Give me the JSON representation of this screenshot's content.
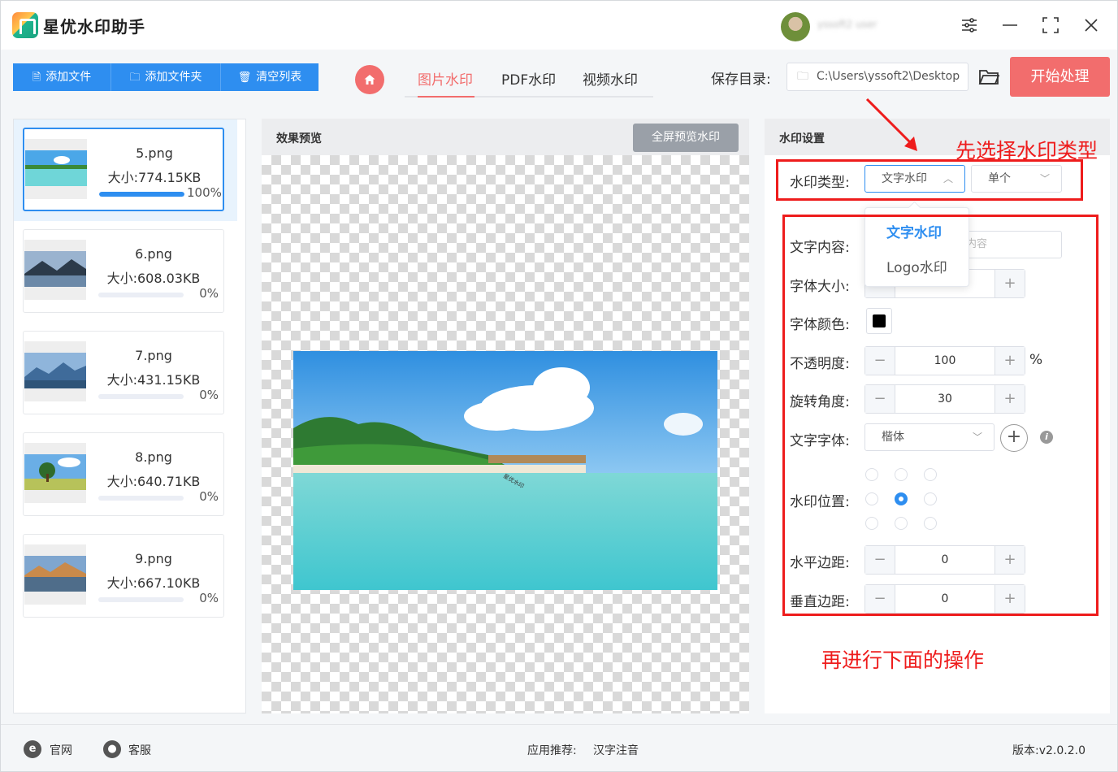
{
  "app": {
    "title": "星优水印助手",
    "user_name": "yssoft2 user"
  },
  "window_controls": {
    "settings_icon": "sliders-icon",
    "minimize_icon": "minimize-icon",
    "maximize_icon": "maximize-icon",
    "close_icon": "close-icon"
  },
  "toolbar": {
    "add_file": "添加文件",
    "add_folder": "添加文件夹",
    "clear_list": "清空列表"
  },
  "tabs": [
    {
      "label": "图片水印",
      "active": true
    },
    {
      "label": "PDF水印"
    },
    {
      "label": "视频水印"
    }
  ],
  "save": {
    "label": "保存目录:",
    "path": "C:\\Users\\yssoft2\\Desktop"
  },
  "start_button": "开始处理",
  "files": [
    {
      "name": "5.png",
      "size": "大小:774.15KB",
      "progress_text": "100%",
      "progress": 1.0,
      "selected": true
    },
    {
      "name": "6.png",
      "size": "大小:608.03KB",
      "progress_text": "0%",
      "progress": 0
    },
    {
      "name": "7.png",
      "size": "大小:431.15KB",
      "progress_text": "0%",
      "progress": 0
    },
    {
      "name": "8.png",
      "size": "大小:640.71KB",
      "progress_text": "0%",
      "progress": 0
    },
    {
      "name": "9.png",
      "size": "大小:667.10KB",
      "progress_text": "0%",
      "progress": 0
    }
  ],
  "preview": {
    "title": "效果预览",
    "fullscreen_button": "全屏预览水印"
  },
  "settings": {
    "title": "水印设置",
    "type_label": "水印类型:",
    "type_value": "文字水印",
    "mode_value": "单个",
    "dropdown_options": [
      "文字水印",
      "Logo水印"
    ],
    "text_label": "文字内容:",
    "text_placeholder": "内容",
    "font_size_label": "字体大小:",
    "font_color_label": "字体颜色:",
    "font_color": "#000000",
    "opacity_label": "不透明度:",
    "opacity_value": "100",
    "opacity_unit": "%",
    "rotation_label": "旋转角度:",
    "rotation_value": "30",
    "font_family_label": "文字字体:",
    "font_family_value": "楷体",
    "position_label": "水印位置:",
    "position_selected": "center",
    "h_margin_label": "水平边距:",
    "h_margin_value": "0",
    "v_margin_label": "垂直边距:",
    "v_margin_value": "0"
  },
  "annotations": {
    "step1": "先选择水印类型",
    "step2": "再进行下面的操作"
  },
  "statusbar": {
    "website": "官网",
    "support": "客服",
    "recommend_label": "应用推荐:",
    "recommend_value": "汉字注音",
    "version": "版本:v2.0.2.0"
  },
  "colors": {
    "accent": "#2e8ef0",
    "brand_red": "#f26d6d",
    "annotation": "#ee1c1c"
  }
}
